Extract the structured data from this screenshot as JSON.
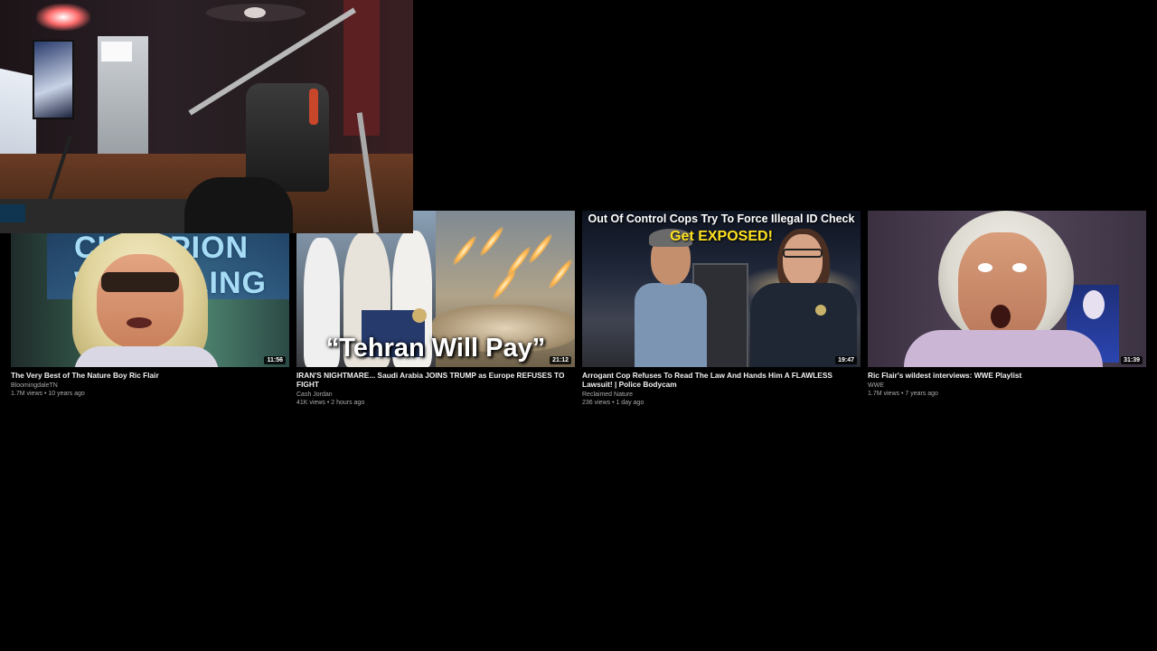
{
  "videos": [
    {
      "title": "The Very Best of The Nature Boy Ric Flair",
      "channel": "BloomingdaleTN",
      "meta": "1.7M views • 10 years ago",
      "duration": "11:56",
      "thumb_text": "CHAMPION WRESTLING"
    },
    {
      "title": "IRAN'S NIGHTMARE... Saudi Arabia JOINS TRUMP as Europe REFUSES TO FIGHT",
      "channel": "Cash Jordan",
      "meta": "41K views • 2 hours ago",
      "duration": "21:12",
      "thumb_text": "“Tehran Will Pay”"
    },
    {
      "title": "Arrogant Cop Refuses To Read The Law And Hands Him A FLAWLESS Lawsuit! | Police Bodycam",
      "channel": "Reclaimed Nature",
      "meta": "236 views • 1 day ago",
      "duration": "19:47",
      "thumb_text_1": "Out Of Control Cops Try To Force Illegal ID Check",
      "thumb_text_2": "Get EXPOSED!"
    },
    {
      "title": "Ric Flair's wildest interviews: WWE Playlist",
      "channel": "WWE",
      "meta": "1.7M views • 7 years ago",
      "duration": "31:39"
    }
  ]
}
